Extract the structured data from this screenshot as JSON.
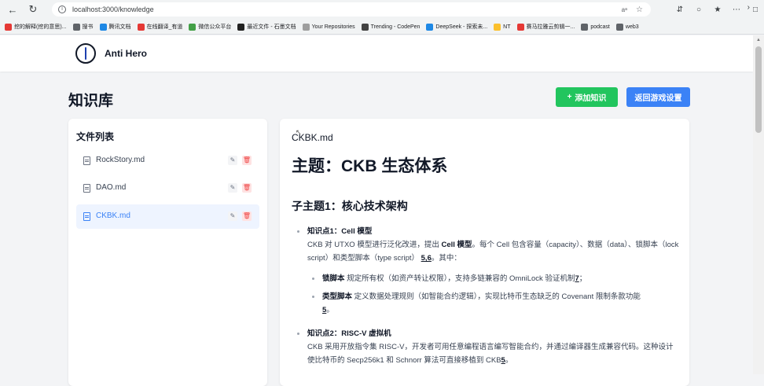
{
  "browser": {
    "url": "localhost:3000/knowledge",
    "bookmarks": [
      {
        "label": "挖的解释(挖的意思)...",
        "color": "#e53935"
      },
      {
        "label": "搜书",
        "color": "#5f6368"
      },
      {
        "label": "腾讯文档",
        "color": "#1e88e5"
      },
      {
        "label": "在线翻译_有道",
        "color": "#e53935"
      },
      {
        "label": "微信公众平台",
        "color": "#43a047"
      },
      {
        "label": "最近文件 - 石墨文档",
        "color": "#212121"
      },
      {
        "label": "Your Repositories",
        "color": "#9e9e9e"
      },
      {
        "label": "Trending - CodePen",
        "color": "#424242"
      },
      {
        "label": "DeepSeek - 探索未...",
        "color": "#1e88e5"
      },
      {
        "label": "NT",
        "color": "#fbc02d"
      },
      {
        "label": "赛马拉雅云剪辑一...",
        "color": "#e53935"
      },
      {
        "label": "podcast",
        "color": "#5f6368"
      },
      {
        "label": "web3",
        "color": "#5f6368"
      }
    ]
  },
  "header": {
    "brand": "Anti Hero"
  },
  "page": {
    "title": "知识库",
    "add_button": "添加知识",
    "back_button": "返回游戏设置"
  },
  "files": {
    "title": "文件列表",
    "items": [
      {
        "name": "RockStory.md"
      },
      {
        "name": "DAO.md"
      },
      {
        "name": "CKBK.md"
      }
    ],
    "active_index": 2
  },
  "document": {
    "filename": "CKBK.md",
    "h1": "主题：CKB 生态体系",
    "h2": "子主题1：核心技术架构",
    "point1": {
      "title": "知识点1：Cell 模型",
      "text_a": "CKB 对 UTXO 模型进行泛化改进，提出 ",
      "bold": "Cell 模型",
      "text_b": "。每个 Cell 包含容量（capacity）、数据（data）、锁脚本（lock script）和类型脚本（type script）",
      "ref": "5,6",
      "text_c": "。其中：",
      "sub1_bold": "锁脚本",
      "sub1_text": " 规定所有权（如资产转让权限），支持多链兼容的 OmniLock 验证机制",
      "sub1_ref": "7",
      "sub1_end": "；",
      "sub2_bold": "类型脚本",
      "sub2_text": " 定义数据处理规则（如智能合约逻辑），实现比特币生态缺乏的 Covenant 限制条款功能",
      "sub2_ref": "5",
      "sub2_end": "。"
    },
    "point2": {
      "title": "知识点2：RISC-V 虚拟机",
      "text": "CKB 采用开放指令集 RISC-V，开发者可用任意编程语言编写智能合约，并通过编译器生成兼容代码。这种设计使比特币的 Secp256k1 和 Schnorr 算法可直接移植到 CKB",
      "ref": "5",
      "end": "。"
    }
  }
}
